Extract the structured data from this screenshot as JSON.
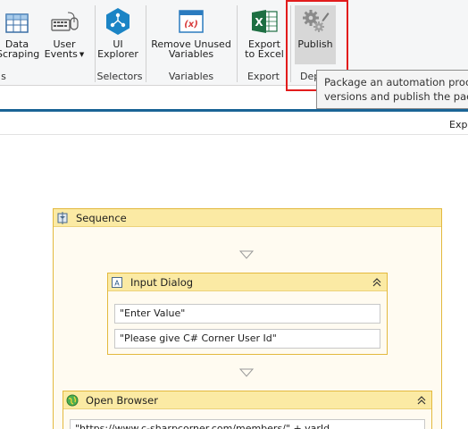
{
  "ribbon": {
    "buttons": {
      "data_scraping": {
        "line1": "Data",
        "line2": "Scraping"
      },
      "user_events": {
        "line1": "User",
        "line2": "Events"
      },
      "ui_explorer": {
        "line1": "UI",
        "line2": "Explorer"
      },
      "remove_unused": {
        "line1": "Remove Unused",
        "line2": "Variables"
      },
      "export_excel": {
        "line1": "Export",
        "line2": "to Excel"
      },
      "publish": {
        "line1": "Publish"
      }
    },
    "groups": {
      "wizards": "s",
      "selectors": "Selectors",
      "variables": "Variables",
      "export": "Export",
      "deploy": "Dep"
    }
  },
  "tooltip": {
    "line1": "Package an automation proces",
    "line2": "versions and publish the packa"
  },
  "toolbar": {
    "expand_label": "Expa"
  },
  "workflow": {
    "sequence": {
      "title": "Sequence"
    },
    "input_dialog": {
      "title": "Input Dialog",
      "fields": [
        "\"Enter Value\"",
        "\"Please give C# Corner User Id\""
      ]
    },
    "open_browser": {
      "title": "Open Browser",
      "url": "\"https://www.c-sharpcorner.com/members/\" + varId"
    }
  },
  "colors": {
    "accent_blue": "#1a6496",
    "highlight_red": "#e21c1c",
    "activity_header": "#fbeaa4",
    "activity_border": "#e3b93e"
  }
}
